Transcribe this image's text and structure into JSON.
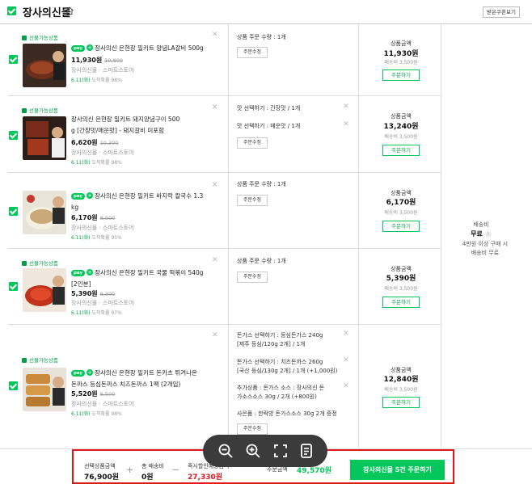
{
  "header": {
    "store_name": "장사의신몰",
    "coupon_button": "받은쿠폰보기"
  },
  "items": [
    {
      "gift_tag": "선물가능상품",
      "pay_badge": "pay",
      "name_lines": [
        "장사의신 은현장 밀키트 양념LA갈비 500g"
      ],
      "price": "11,930원",
      "original_price": "19,800",
      "seller": "장사의신몰 · 스마트스토어",
      "delivery_date": "6.11(화)",
      "delivery_rate": "도착확률 98%",
      "options": [
        {
          "text": "상품 주문 수량 : 1개",
          "removable": false
        }
      ],
      "option_button": "주문수정",
      "amount_label": "상품금액",
      "amount": "11,930원",
      "ship_fee": "배송비 3,500원",
      "order_button": "주문하기"
    },
    {
      "gift_tag": "선물가능상품",
      "pay_badge": "",
      "name_lines": [
        "장사의신 은현장 밀키트 돼지양념구이 500",
        "g [간장맛/매운맛] - 돼지갈비 미포함"
      ],
      "price": "6,620원",
      "original_price": "10,300",
      "seller": "장사의신몰 · 스마트스토어",
      "delivery_date": "6.11(화)",
      "delivery_rate": "도착확률 98%",
      "options": [
        {
          "text": "맛 선택하기 : 간장맛 / 1개",
          "removable": true
        },
        {
          "text": "맛 선택하기 : 매운맛 / 1개",
          "removable": true
        }
      ],
      "option_button": "주문수정",
      "amount_label": "상품금액",
      "amount": "13,240원",
      "ship_fee": "배송비 3,500원",
      "order_button": "주문하기"
    },
    {
      "gift_tag": "",
      "pay_badge": "pay",
      "name_lines": [
        "장사의신 은현장 밀키트 바지락 칼국수 1.3",
        "kg"
      ],
      "price": "6,170원",
      "original_price": "8,500",
      "seller": "장사의신몰 · 스마트스토어",
      "delivery_date": "6.11(화)",
      "delivery_rate": "도착확률 95%",
      "options": [
        {
          "text": "상품 주문 수량 : 1개",
          "removable": false
        }
      ],
      "option_button": "주문수정",
      "amount_label": "상품금액",
      "amount": "6,170원",
      "ship_fee": "배송비 3,500원",
      "order_button": "주문하기"
    },
    {
      "gift_tag": "선물가능상품",
      "pay_badge": "pay",
      "name_lines": [
        "장사의신 은현장 밀키트 국물 떡볶이 540g",
        "[2인분]"
      ],
      "price": "5,390원",
      "original_price": "8,300",
      "seller": "장사의신몰 · 스마트스토어",
      "delivery_date": "6.11(화)",
      "delivery_rate": "도착확률 97%",
      "options": [
        {
          "text": "상품 주문 수량 : 1개",
          "removable": false
        }
      ],
      "option_button": "주문수정",
      "amount_label": "상품금액",
      "amount": "5,390원",
      "ship_fee": "배송비 3,500원",
      "order_button": "주문하기"
    },
    {
      "gift_tag": "선물가능상품",
      "pay_badge": "pay",
      "name_lines": [
        "장사의신 은현장 밀키트 돈카츠 튀겨나온",
        "돈까스 등심돈까스 치즈돈까스 1팩 (2개입)"
      ],
      "price": "5,520원",
      "original_price": "8,500",
      "seller": "장사의신몰 · 스마트스토어",
      "delivery_date": "6.11(화)",
      "delivery_rate": "도착확률 98%",
      "options": [
        {
          "text": "돈가스 선택하기 : 등심돈가스 240g",
          "removable": true
        },
        {
          "text": "[제주 등심/120g 2개] / 1개",
          "removable": false
        },
        {
          "text": "돈가스 선택하기 : 치즈돈까스 260g",
          "removable": true
        },
        {
          "text": "[국산 등심/130g 2개] / 1개 (+1,000원)",
          "removable": false
        },
        {
          "text": "추가상품 : 돈가스 소스 : 장사의신 돈",
          "removable": true
        },
        {
          "text": "가소스소스 30g / 2개 (+800원)",
          "removable": false
        },
        {
          "text": "사은품 : 한락방 돈가스소스 30g 2개 증정",
          "removable": false
        }
      ],
      "option_button": "주문수정",
      "amount_label": "상품금액",
      "amount": "12,840원",
      "ship_fee": "배송비 3,500원",
      "order_button": "주문하기"
    }
  ],
  "shipping": {
    "label": "배송비",
    "value": "무료",
    "note_lines": [
      "4만원 이상 구매 시",
      "배송비 무료"
    ]
  },
  "summary": {
    "selected_label": "선택상품금액",
    "selected_value": "76,900원",
    "plus": "+",
    "ship_label": "총 배송비",
    "ship_value": "0원",
    "minus": "−",
    "discount_label": "즉시할인예상금액",
    "discount_value": "27,330원",
    "total_label": "주문금액",
    "total_value": "49,570원",
    "buy_button": "장사의신몰 5건 주문하기"
  },
  "viewer_toolbar": [
    "zoom-out-icon",
    "zoom-in-icon",
    "fullscreen-icon",
    "document-icon"
  ],
  "colors": {
    "brand_green": "#03c75a",
    "discount_red": "#e3161b",
    "highlight_red": "#e3161b"
  }
}
